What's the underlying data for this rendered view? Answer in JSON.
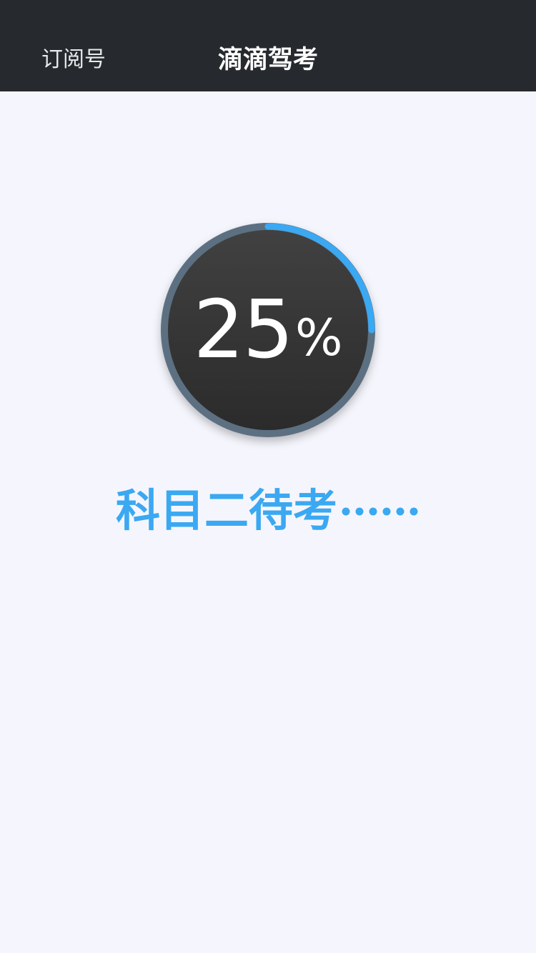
{
  "header": {
    "back_label": "订阅号",
    "title": "滴滴驾考"
  },
  "progress": {
    "value": 25,
    "number": "25",
    "unit": "%",
    "track_color": "#5b6f82",
    "fill_color": "#3ba8f2",
    "face_color": "#333333"
  },
  "status": {
    "text": "科目二待考",
    "ellipsis": "……",
    "color": "#3ba8f2"
  },
  "colors": {
    "topbar": "#262a2e",
    "background": "#f5f6fd"
  }
}
